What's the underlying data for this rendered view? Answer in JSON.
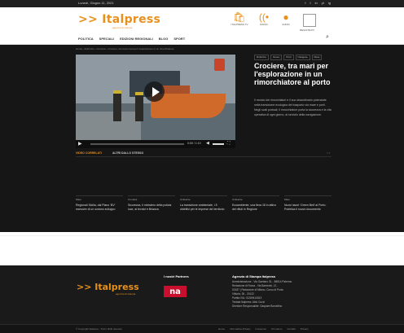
{
  "topbar": {
    "date": "Lunedì, Giugno 11, 2021",
    "social": [
      "f",
      "t",
      "in",
      "yt",
      "ig"
    ]
  },
  "header": {
    "logo": ">> Italpress",
    "logo_sub": "agenzia di stampa",
    "icons": [
      {
        "name": "ecommerce-icon",
        "glyph": "🛍",
        "label": "ITALPRESS TV"
      },
      {
        "name": "radio-icon",
        "glyph": "((•",
        "label": "RADIO"
      },
      {
        "name": "audio-icon",
        "glyph": "●",
        "label": "AUDIO"
      }
    ],
    "box_label": "REGISTRATI"
  },
  "nav": {
    "items": [
      "POLITICA",
      "SPECIALI",
      "EDIZIONI REGIONALI",
      "BLOG",
      "SPORT"
    ],
    "search_icon": "⌕"
  },
  "breadcrumb": "Home › Rubriche › Crociera › Crociere, tra nuovi mari per l'esplorazione in un rimorchiatore",
  "video": {
    "time": "0:00 / 1:10",
    "play_icon": "▶"
  },
  "article": {
    "tags": [
      "Rubriche",
      "Green",
      "Porti",
      "Navigare",
      "Mare"
    ],
    "title": "Crociere, tra mari per l'esplorazione in un rimorchiatore al porto",
    "body": "Il mondo dei rimorchiatori e il suo straordinario potenziale nella transizione ecologica del trasporto via mare e porti. Negli scali portuali, il rimorchiatore porta la sicurezza e la vita operativa di ogni giorno, al servizio della navigazione."
  },
  "section": {
    "tab_active": "VIDEO CORRELATI",
    "tab_other": "ALTRI DALLO STESSO",
    "arrows": "‹ ›"
  },
  "cards": [
    {
      "cat": "Mare",
      "title": "Regionali Sicilia, dal Piano ‘BV’ manovre di un oceano sviluppo"
    },
    {
      "cat": "Cronaca",
      "title": "Sicurezza, il ministero della polizia luce, ai tecnici e Brianza"
    },
    {
      "cat": "Ambiente",
      "title": "La transizione ambientale, i 5 obiettivi per le imprese del territorio"
    },
    {
      "cat": "Ambiente",
      "title": "Ecoambiente, una fiera 18 in attivo dei rifiuti in Regione"
    },
    {
      "cat": "Mare",
      "title": "Nuovi lavori ‘Green Belt’ al Porto. Pubblica il nuovo documento"
    }
  ],
  "footer": {
    "logo": ">> Italpress",
    "logo_sub": "agenzia di stampa",
    "partners_title": "I nostri Partners",
    "partner_logo": "na",
    "agency_title": "Agenzia di Stampa Italpress",
    "address_lines": [
      "Amministrazione - Via Gaetano Gl... 88514 Palermo",
      "Redazione di Roma - Via Barberini, 12 -",
      "00187 | Redazione di Milano, Corso di Porta",
      "Vittoria, 36 - 20122",
      "Partita IVA: 01269410813",
      "Testata Italpress: Aldo Cuzzi",
      "Direttore Responsabile: Gaspare Borsellino"
    ],
    "copyright": "© Copyright Italpress - Tutti i diritti riservati",
    "links": [
      "Home",
      "Informativa Privacy",
      "Consenso",
      "Chi siamo",
      "Contatti",
      "Privacy"
    ]
  }
}
